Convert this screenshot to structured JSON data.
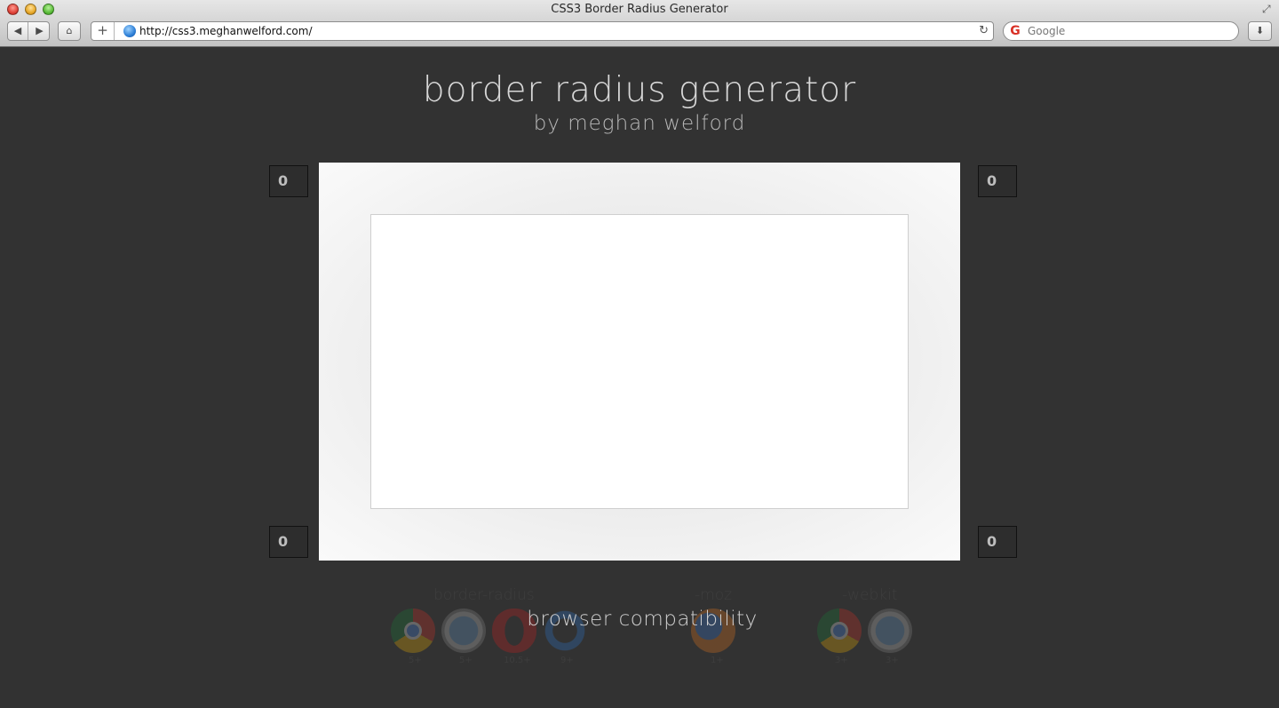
{
  "browser": {
    "window_title": "CSS3 Border Radius Generator",
    "url": "http://css3.meghanwelford.com/",
    "search_placeholder": "Google",
    "icons": [
      "close-window",
      "minimize-window",
      "zoom-window",
      "back-arrow",
      "forward-arrow",
      "home",
      "add-bookmark",
      "globe",
      "reload",
      "google-logo",
      "downloads",
      "fullscreen"
    ]
  },
  "page": {
    "title": "border radius generator",
    "subtitle": "by meghan welford",
    "corners": {
      "top_left": "0",
      "top_right": "0",
      "bottom_left": "0",
      "bottom_right": "0"
    },
    "compatibility": {
      "title": "browser compatibility",
      "groups": [
        {
          "label": "border-radius",
          "browsers": [
            {
              "icon": "chrome-icon",
              "version": "5+"
            },
            {
              "icon": "safari-icon",
              "version": "5+"
            },
            {
              "icon": "opera-icon",
              "version": "10.5+"
            },
            {
              "icon": "ie-icon",
              "version": "9+"
            }
          ]
        },
        {
          "label": "-moz",
          "browsers": [
            {
              "icon": "firefox-icon",
              "version": "1+"
            }
          ]
        },
        {
          "label": "-webkit",
          "browsers": [
            {
              "icon": "chrome-icon",
              "version": "3+"
            },
            {
              "icon": "safari-icon",
              "version": "3+"
            }
          ]
        }
      ]
    }
  },
  "colors": {
    "page_background": "#323232",
    "preview_background": "#ffffff",
    "heading_text": "#d8d8d8"
  }
}
